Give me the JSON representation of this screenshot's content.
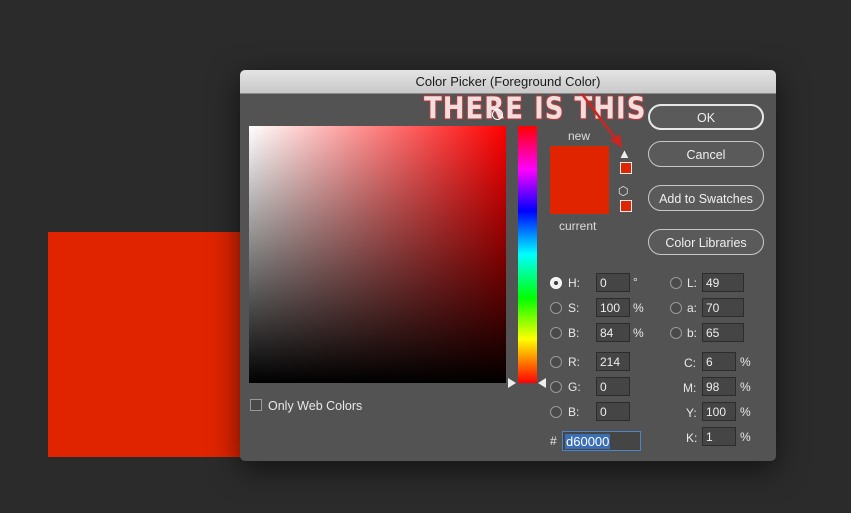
{
  "dialog": {
    "title": "Color Picker (Foreground Color)",
    "annotation": "THERE IS THIS"
  },
  "labels": {
    "new": "new",
    "current": "current"
  },
  "colors": {
    "new": "#e02400",
    "current": "#e02400",
    "accent_hex": "#3a6fb5"
  },
  "icons": {
    "gamut_warning": "warning-triangle-icon",
    "web_safe": "cube-icon"
  },
  "buttons": {
    "ok": "OK",
    "cancel": "Cancel",
    "add_swatches": "Add to Swatches",
    "libraries": "Color Libraries"
  },
  "fields": {
    "h": {
      "label": "H:",
      "value": "0",
      "unit": "°"
    },
    "s": {
      "label": "S:",
      "value": "100",
      "unit": "%"
    },
    "b": {
      "label": "B:",
      "value": "84",
      "unit": "%"
    },
    "r": {
      "label": "R:",
      "value": "214"
    },
    "g": {
      "label": "G:",
      "value": "0"
    },
    "bl": {
      "label": "B:",
      "value": "0"
    },
    "L": {
      "label": "L:",
      "value": "49"
    },
    "a": {
      "label": "a:",
      "value": "70"
    },
    "lb": {
      "label": "b:",
      "value": "65"
    },
    "c": {
      "label": "C:",
      "value": "6",
      "unit": "%"
    },
    "m": {
      "label": "M:",
      "value": "98",
      "unit": "%"
    },
    "y": {
      "label": "Y:",
      "value": "100",
      "unit": "%"
    },
    "k": {
      "label": "K:",
      "value": "1",
      "unit": "%"
    }
  },
  "hex": {
    "prefix": "#",
    "value": "d60000"
  },
  "web_colors": {
    "label": "Only Web Colors",
    "checked": false
  }
}
